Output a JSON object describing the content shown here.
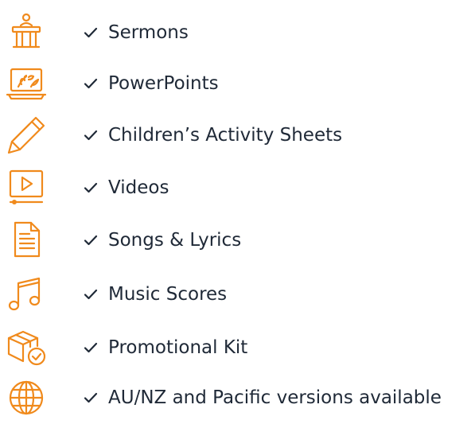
{
  "brand_color": "#f08a1c",
  "items": [
    {
      "icon": "pulpit-icon",
      "label": "Sermons"
    },
    {
      "icon": "presentation-laptop-icon",
      "label": "PowerPoints"
    },
    {
      "icon": "pencil-icon",
      "label": "Children’s Activity Sheets"
    },
    {
      "icon": "video-play-icon",
      "label": "Videos"
    },
    {
      "icon": "document-lines-icon",
      "label": "Songs & Lyrics"
    },
    {
      "icon": "music-note-icon",
      "label": "Music Scores"
    },
    {
      "icon": "box-check-icon",
      "label": "Promotional Kit"
    },
    {
      "icon": "globe-icon",
      "label": "AU/NZ and Pacific versions available"
    }
  ]
}
